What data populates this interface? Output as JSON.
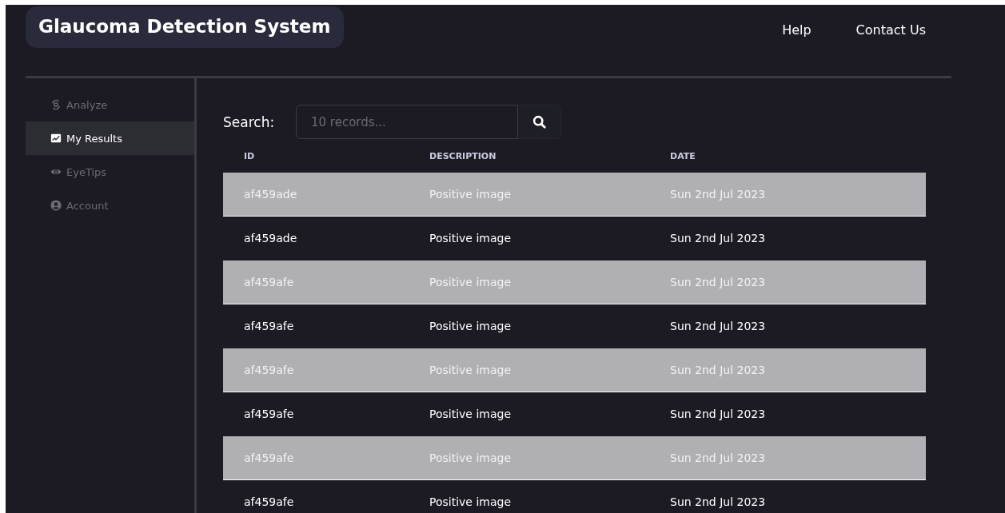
{
  "header": {
    "title": "Glaucoma Detection System",
    "links": [
      "Help",
      "Contact Us"
    ]
  },
  "sidebar": {
    "items": [
      {
        "label": "Analyze",
        "kind": "analyze",
        "selected": false
      },
      {
        "label": "My Results",
        "kind": "results",
        "selected": true
      },
      {
        "label": "EyeTips",
        "kind": "tips",
        "selected": false
      },
      {
        "label": "Account",
        "kind": "account",
        "selected": false
      }
    ]
  },
  "search": {
    "label": "Search:",
    "placeholder": "10 records..."
  },
  "table": {
    "columns": [
      "ID",
      "DESCRIPTION",
      "DATE"
    ],
    "rows": [
      [
        "af459ade",
        "Positive image",
        "Sun 2nd Jul 2023"
      ],
      [
        "af459ade",
        "Positive image",
        "Sun 2nd Jul 2023"
      ],
      [
        "af459afe",
        "Positive image",
        "Sun 2nd Jul 2023"
      ],
      [
        "af459afe",
        "Positive image",
        "Sun 2nd Jul 2023"
      ],
      [
        "af459afe",
        "Positive image",
        "Sun 2nd Jul 2023"
      ],
      [
        "af459afe",
        "Positive image",
        "Sun 2nd Jul 2023"
      ],
      [
        "af459afe",
        "Positive image",
        "Sun 2nd Jul 2023"
      ],
      [
        "af459afe",
        "Positive image",
        "Sun 2nd Jul 2023"
      ]
    ]
  }
}
